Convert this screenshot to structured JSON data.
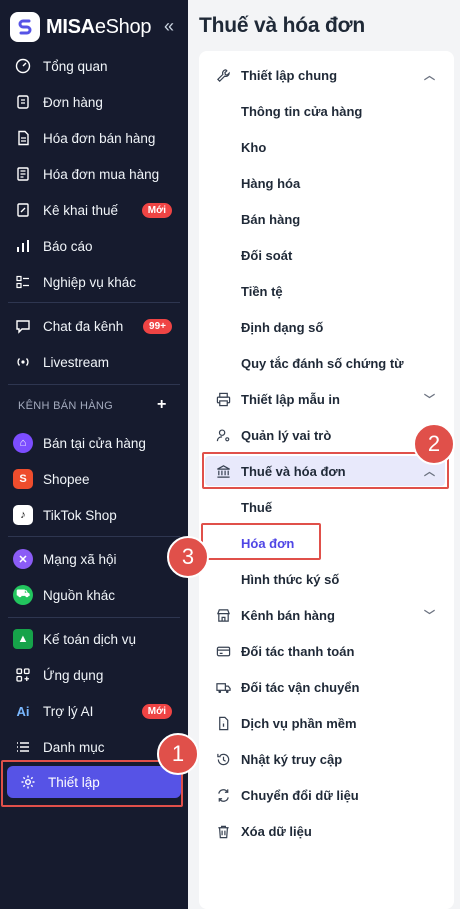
{
  "brand": {
    "name_bold": "MISA",
    "name_light": "eShop"
  },
  "sidebar": {
    "collapse_label": "«",
    "items": [
      {
        "label": "Tổng quan",
        "icon": "gauge-icon"
      },
      {
        "label": "Đơn hàng",
        "icon": "order-icon"
      },
      {
        "label": "Hóa đơn bán hàng",
        "icon": "invoice-icon"
      },
      {
        "label": "Hóa đơn mua hàng",
        "icon": "purchase-invoice-icon"
      },
      {
        "label": "Kê khai thuế",
        "icon": "tax-icon",
        "badge": "Mới"
      },
      {
        "label": "Báo cáo",
        "icon": "chart-icon"
      },
      {
        "label": "Nghiệp vụ khác",
        "icon": "list-icon"
      },
      {
        "label": "Chat đa kênh",
        "icon": "chat-icon",
        "badge": "99+"
      },
      {
        "label": "Livestream",
        "icon": "broadcast-icon"
      }
    ],
    "section_label": "KÊNH BÁN HÀNG",
    "section_add": "+",
    "channels": [
      {
        "label": "Bán tại cửa hàng",
        "icon": "store-icon",
        "color": "#7c4dff"
      },
      {
        "label": "Shopee",
        "icon": "shopee-icon",
        "color": "#ee4d2d"
      },
      {
        "label": "TikTok Shop",
        "icon": "tiktok-icon",
        "color": "#111111"
      },
      {
        "label": "Mạng xã hội",
        "icon": "social-icon",
        "color": "#8b5cf6"
      },
      {
        "label": "Nguồn khác",
        "icon": "cart-icon",
        "color": "#22c55e"
      }
    ],
    "bottom_items": [
      {
        "label": "Kế toán dịch vụ",
        "icon": "accounting-icon"
      },
      {
        "label": "Ứng dụng",
        "icon": "apps-icon"
      },
      {
        "label": "Trợ lý AI",
        "icon": "ai-icon",
        "badge": "Mới"
      },
      {
        "label": "Danh mục",
        "icon": "catalog-icon"
      }
    ],
    "active_item": {
      "label": "Thiết lập",
      "icon": "gear-icon"
    }
  },
  "page": {
    "title": "Thuế và hóa đơn"
  },
  "settings": {
    "general": {
      "label": "Thiết lập chung",
      "children": [
        "Thông tin cửa hàng",
        "Kho",
        "Hàng hóa",
        "Bán hàng",
        "Đối soát",
        "Tiền tệ",
        "Định dạng số",
        "Quy tắc đánh số chứng từ"
      ]
    },
    "print_templates": "Thiết lập mẫu in",
    "roles": "Quản lý vai trò",
    "tax_invoice": {
      "label": "Thuế và hóa đơn",
      "children": [
        "Thuế",
        "Hóa đơn",
        "Hình thức ký số"
      ],
      "selected": "Hóa đơn"
    },
    "rest": [
      {
        "label": "Kênh bán hàng",
        "icon": "store-icon",
        "chevron": "⌄"
      },
      {
        "label": "Đối tác thanh toán",
        "icon": "card-icon"
      },
      {
        "label": "Đối tác vận chuyển",
        "icon": "truck-icon"
      },
      {
        "label": "Dịch vụ phần mềm",
        "icon": "document-icon"
      },
      {
        "label": "Nhật ký truy cập",
        "icon": "history-icon"
      },
      {
        "label": "Chuyển đổi dữ liệu",
        "icon": "convert-icon"
      },
      {
        "label": "Xóa dữ liệu",
        "icon": "trash-icon"
      }
    ]
  },
  "callouts": {
    "step1": "1",
    "step2": "2",
    "step3": "3",
    "color": "#e0504a"
  },
  "colors": {
    "sidebar_bg": "#161b2e",
    "accent": "#5653e6",
    "selected_text": "#4f46e5"
  }
}
